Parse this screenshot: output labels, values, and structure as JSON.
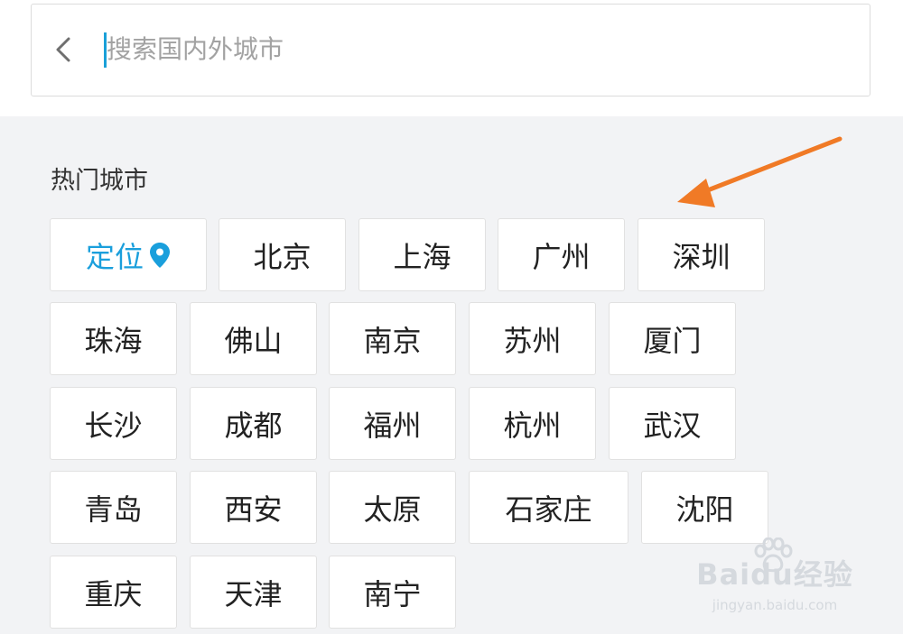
{
  "search": {
    "placeholder": "搜索国内外城市"
  },
  "hot_cities": {
    "title": "热门城市",
    "locate_label": "定位",
    "rows": [
      [
        "北京",
        "上海",
        "广州",
        "深圳"
      ],
      [
        "珠海",
        "佛山",
        "南京",
        "苏州",
        "厦门"
      ],
      [
        "长沙",
        "成都",
        "福州",
        "杭州",
        "武汉"
      ],
      [
        "青岛",
        "西安",
        "太原",
        "石家庄",
        "沈阳"
      ],
      [
        "重庆",
        "天津",
        "南宁"
      ]
    ]
  },
  "watermark": {
    "brand": "Baidu经验",
    "site": "jingyan.baidu.com"
  },
  "colors": {
    "accent": "#1a9fdc",
    "arrow": "#f07a26",
    "background": "#f2f3f5"
  }
}
